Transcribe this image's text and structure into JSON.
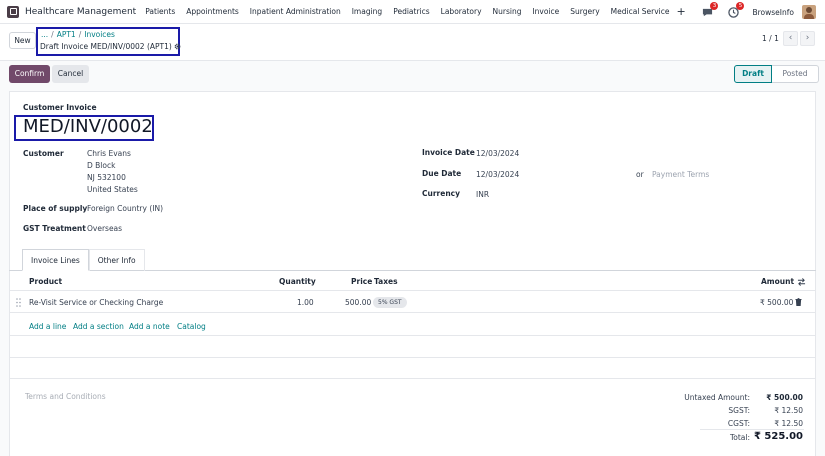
{
  "app": {
    "title": "Healthcare Management"
  },
  "nav": [
    "Patients",
    "Appointments",
    "Inpatient Administration",
    "Imaging",
    "Pediatrics",
    "Laboratory",
    "Nursing",
    "Invoice",
    "Surgery",
    "Medical Service"
  ],
  "topbar": {
    "plus": "+",
    "messages_count": "3",
    "activity_count": "5",
    "company": "BrowseInfo"
  },
  "control": {
    "new_label": "New",
    "breadcrumb": {
      "ellipsis": "...",
      "sep": "/",
      "item1": "APT1",
      "item2": "Invoices"
    },
    "record_title": "Draft Invoice MED/INV/0002 (APT1)",
    "pager": "1 / 1",
    "prev": "‹",
    "next": "›"
  },
  "actions": {
    "confirm": "Confirm",
    "cancel": "Cancel"
  },
  "statusbar": {
    "active": "Draft",
    "next": "Posted"
  },
  "form": {
    "type_label": "Customer Invoice",
    "name": "MED/INV/0002",
    "customer_label": "Customer",
    "customer_lines": [
      "Chris Evans",
      "D Block",
      "NJ 532100",
      "United States"
    ],
    "place_label": "Place of supply",
    "place_value": "Foreign Country (IN)",
    "gst_label": "GST Treatment",
    "gst_value": "Overseas",
    "invoice_date_label": "Invoice Date",
    "invoice_date": "12/03/2024",
    "due_date_label": "Due Date",
    "due_date": "12/03/2024",
    "or_label": "or",
    "payment_terms_placeholder": "Payment Terms",
    "currency_label": "Currency",
    "currency": "INR"
  },
  "tabs": {
    "lines": "Invoice Lines",
    "other": "Other Info"
  },
  "table": {
    "headers": {
      "product": "Product",
      "quantity": "Quantity",
      "price": "Price",
      "taxes": "Taxes",
      "amount": "Amount"
    },
    "rows": [
      {
        "product": "Re-Visit Service or Checking Charge",
        "quantity": "1.00",
        "price": "500.00",
        "tax": "5% GST",
        "amount": "₹ 500.00"
      }
    ],
    "add_line": "Add a line",
    "add_section": "Add a section",
    "add_note": "Add a note",
    "catalog": "Catalog"
  },
  "footer": {
    "terms_placeholder": "Terms and Conditions",
    "untaxed_label": "Untaxed Amount:",
    "untaxed": "₹ 500.00",
    "sgst_label": "SGST:",
    "sgst": "₹ 12.50",
    "cgst_label": "CGST:",
    "cgst": "₹ 12.50",
    "total_label": "Total:",
    "total": "₹ 525.00"
  },
  "colors": {
    "brand": "#71496a",
    "link": "#017e84",
    "highlight_box": "#1a1aa8"
  },
  "icons": {
    "app": "app-grid-icon",
    "chat": "chat-icon",
    "clock": "clock-icon",
    "gear": "gear-icon",
    "delete": "trash-icon",
    "columns": "column-toggle-icon",
    "handle": "drag-handle-icon"
  }
}
